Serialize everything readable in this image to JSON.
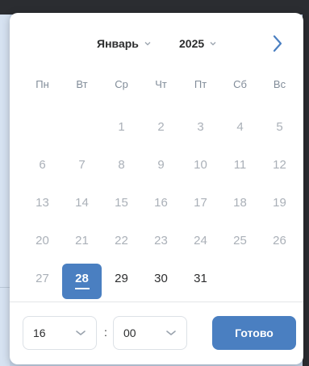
{
  "header": {
    "month": "Январь",
    "year": "2025"
  },
  "weekdays": [
    "Пн",
    "Вт",
    "Ср",
    "Чт",
    "Пт",
    "Сб",
    "Вс"
  ],
  "weeks": [
    [
      "",
      "",
      "1",
      "2",
      "3",
      "4",
      "5"
    ],
    [
      "6",
      "7",
      "8",
      "9",
      "10",
      "11",
      "12"
    ],
    [
      "13",
      "14",
      "15",
      "16",
      "17",
      "18",
      "19"
    ],
    [
      "20",
      "21",
      "22",
      "23",
      "24",
      "25",
      "26"
    ],
    [
      "27",
      "28",
      "29",
      "30",
      "31",
      "",
      ""
    ]
  ],
  "selected_day": "28",
  "time": {
    "hour": "16",
    "separator": ":",
    "minute": "00"
  },
  "done_label": "Готово",
  "colors": {
    "accent": "#4a7fc1",
    "text": "#2c2d2e",
    "muted": "#aab0b8",
    "weekday": "#818c99"
  }
}
